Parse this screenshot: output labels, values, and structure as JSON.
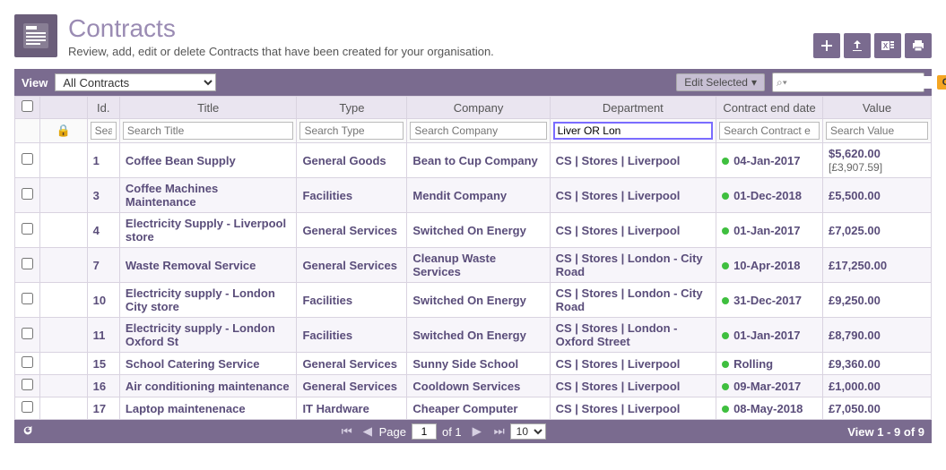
{
  "header": {
    "title": "Contracts",
    "subtitle": "Review, add, edit or delete Contracts that have been created for your organisation."
  },
  "toolbar": {
    "view_label": "View",
    "view_value": "All Contracts",
    "edit_selected": "Edit Selected",
    "go": "Go",
    "search_prefix": "⌕▾"
  },
  "columns": {
    "id": "Id.",
    "title": "Title",
    "type": "Type",
    "company": "Company",
    "department": "Department",
    "end_date": "Contract end date",
    "value": "Value"
  },
  "filters": {
    "id": "Sea",
    "title": "Search Title",
    "type": "Search Type",
    "company": "Search Company",
    "department": "Liver OR Lon",
    "end_date": "Search Contract e",
    "value": "Search Value"
  },
  "rows": [
    {
      "id": "1",
      "title": "Coffee Bean Supply",
      "type": "General Goods",
      "company": "Bean to Cup Company",
      "department": "CS | Stores | Liverpool",
      "end_date": "04-Jan-2017",
      "value": "$5,620.00",
      "value2": "[£3,907.59]"
    },
    {
      "id": "3",
      "title": "Coffee Machines Maintenance",
      "type": "Facilities",
      "company": "Mendit Company",
      "department": "CS | Stores | Liverpool",
      "end_date": "01-Dec-2018",
      "value": "£5,500.00"
    },
    {
      "id": "4",
      "title": "Electricity Supply - Liverpool store",
      "type": "General Services",
      "company": "Switched On Energy",
      "department": "CS | Stores | Liverpool",
      "end_date": "01-Jan-2017",
      "value": "£7,025.00"
    },
    {
      "id": "7",
      "title": "Waste Removal Service",
      "type": "General Services",
      "company": "Cleanup Waste Services",
      "department": "CS | Stores | London - City Road",
      "end_date": "10-Apr-2018",
      "value": "£17,250.00"
    },
    {
      "id": "10",
      "title": "Electricity supply - London City store",
      "type": "Facilities",
      "company": "Switched On Energy",
      "department": "CS | Stores | London - City Road",
      "end_date": "31-Dec-2017",
      "value": "£9,250.00"
    },
    {
      "id": "11",
      "title": "Electricity supply - London Oxford St",
      "type": "Facilities",
      "company": "Switched On Energy",
      "department": "CS | Stores | London - Oxford Street",
      "end_date": "01-Jan-2017",
      "value": "£8,790.00"
    },
    {
      "id": "15",
      "title": "School Catering Service",
      "type": "General Services",
      "company": "Sunny Side School",
      "department": "CS | Stores | Liverpool",
      "end_date": "Rolling",
      "value": "£9,360.00"
    },
    {
      "id": "16",
      "title": "Air conditioning maintenance",
      "type": "General Services",
      "company": "Cooldown Services",
      "department": "CS | Stores | Liverpool",
      "end_date": "09-Mar-2017",
      "value": "£1,000.00"
    },
    {
      "id": "17",
      "title": "Laptop maintenenace",
      "type": "IT Hardware",
      "company": "Cheaper Computer",
      "department": "CS | Stores | Liverpool",
      "end_date": "08-May-2018",
      "value": "£7,050.00"
    }
  ],
  "footer": {
    "page_label": "Page",
    "page_num": "1",
    "of_label": "of 1",
    "per_page": "10",
    "range": "View 1 - 9 of 9"
  }
}
